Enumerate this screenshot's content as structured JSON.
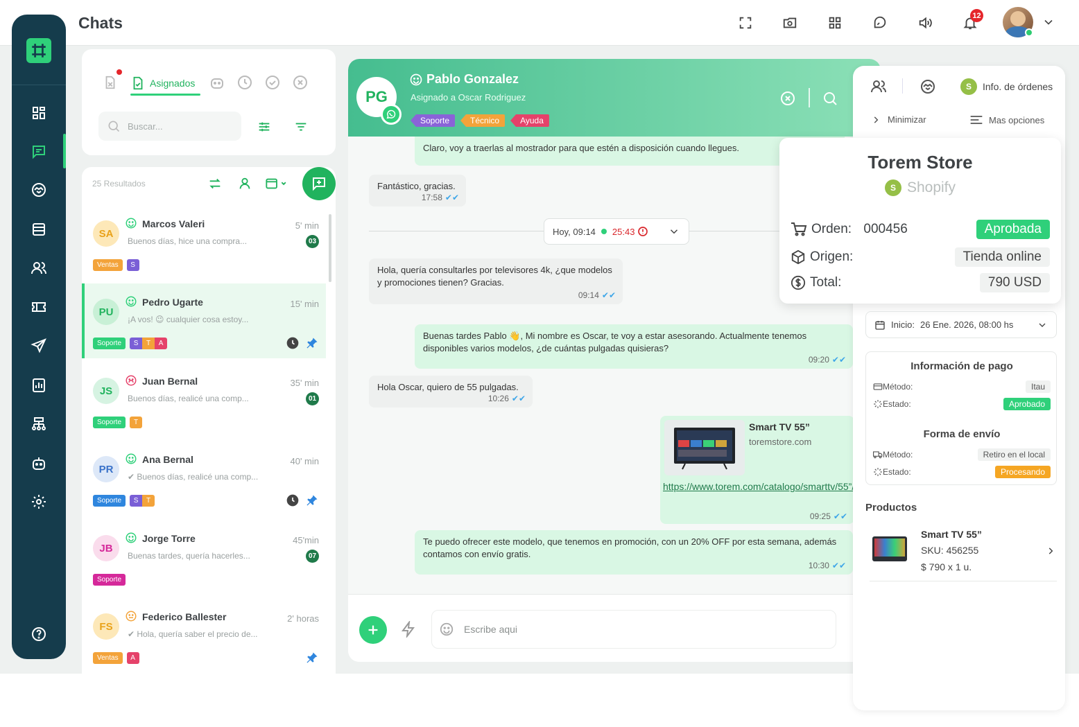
{
  "header": {
    "title": "Chats",
    "icons": [
      "fullscreen-icon",
      "camera-folder-icon",
      "apps-grid-icon",
      "chat-bubble-icon",
      "volume-icon",
      "bell-icon"
    ],
    "notifications_count": "12"
  },
  "sidebar": {
    "items": [
      "dashboard-icon",
      "chat-icon",
      "handshake-icon",
      "list-icon",
      "users-icon",
      "ticket-icon",
      "send-icon",
      "stats-icon",
      "org-chart-icon",
      "bot-icon",
      "settings-icon",
      "help-icon"
    ]
  },
  "list_filters": {
    "active_tab": "Asignados",
    "search_placeholder": "Buscar..."
  },
  "chat_list": {
    "results": "25 Resultados",
    "items": [
      {
        "initials": "SA",
        "name": "Marcos Valeri",
        "preview": "Buenos días, hice una compra...",
        "time": "5' min",
        "badge": "03",
        "tag": "Ventas",
        "mini": [
          "S"
        ]
      },
      {
        "initials": "PU",
        "name": "Pedro Ugarte",
        "preview": "¡A vos! 😉 cualquier cosa estoy...",
        "time": "15' min",
        "badge": "",
        "tag": "Soporte",
        "mini": [
          "S",
          "T",
          "A"
        ]
      },
      {
        "initials": "JS",
        "name": "Juan Bernal",
        "preview": "Buenos días, realicé una comp...",
        "time": "35' min",
        "badge": "01",
        "tag": "Soporte",
        "mini": [
          "T"
        ]
      },
      {
        "initials": "PR",
        "name": "Ana Bernal",
        "preview": "✔ Buenos días, realicé una comp...",
        "time": "40' min",
        "badge": "",
        "tag": "Soporte",
        "mini": [
          "S",
          "T"
        ]
      },
      {
        "initials": "JB",
        "name": "Jorge Torre",
        "preview": "Buenas tardes, quería hacerles...",
        "time": "45'min",
        "badge": "07",
        "tag": "Soporte",
        "mini": []
      },
      {
        "initials": "FS",
        "name": "Federico Ballester",
        "preview": "✔ Hola, quería saber el precio de...",
        "time": "2' horas",
        "badge": "",
        "tag": "Ventas",
        "mini": [
          "A"
        ]
      }
    ]
  },
  "chat": {
    "avatar_initials": "PG",
    "contact_name": "Pablo Gonzalez",
    "assigned_to": "Asignado a Oscar Rodriguez",
    "tags": [
      "Soporte",
      "Técnico",
      "Ayuda"
    ],
    "date_label": "Hoy, 09:14",
    "timer": "25:43",
    "messages": [
      {
        "dir": "out",
        "text": "Claro, voy a traerlas al mostrador para que estén a disposición cuando llegues.",
        "time": ""
      },
      {
        "dir": "in",
        "text": "Fantástico, gracias.",
        "time": "17:58"
      },
      {
        "dir": "in",
        "text": "Hola, quería consultarles por televisores 4k, ¿que modelos y promociones tienen? Gracias.",
        "time": "09:14"
      },
      {
        "dir": "out",
        "text": "Buenas tardes Pablo 👋, Mi nombre es Oscar, te voy a estar asesorando. Actualmente tenemos disponibles varios modelos, ¿de cuántas pulgadas quisieras?",
        "time": "09:20"
      },
      {
        "dir": "in",
        "text": "Hola Oscar, quiero de 55 pulgadas.",
        "time": "10:26"
      },
      {
        "dir": "out",
        "text": "Te puedo ofrecer este modelo, que tenemos en promoción, con un 20% OFF por esta semana, además contamos con envío gratis.",
        "time": "10:30"
      }
    ],
    "link_preview": {
      "title": "Smart TV 55”",
      "domain": "toremstore.com",
      "url": "https://www.torem.com/catalogo/smarttv/55”/Torem",
      "time": "09:25"
    },
    "composer_placeholder": "Escribe aqui"
  },
  "right_panel": {
    "tab_orders": "Info. de órdenes",
    "minimize": "Minimizar",
    "more_options": "Mas opciones",
    "store": {
      "name": "Torem Store",
      "platform": "Shopify",
      "order_label": "Orden:",
      "order_number": "000456",
      "order_status": "Aprobada",
      "origin_label": "Origen:",
      "origin_value": "Tienda online",
      "total_label": "Total:",
      "total_value": "790 USD"
    },
    "start_label": "Inicio:",
    "start_value": "26 Ene. 2026, 08:00 hs",
    "payment": {
      "title": "Información de pago",
      "method_label": "Método:",
      "method_value": "Itau",
      "status_label": "Estado:",
      "status_value": "Aprobado"
    },
    "shipping": {
      "title": "Forma de envío",
      "method_label": "Método:",
      "method_value": "Retiro en el local",
      "status_label": "Estado:",
      "status_value": "Procesando"
    },
    "products_title": "Productos",
    "product": {
      "name": "Smart TV 55”",
      "sku": "SKU: 456255",
      "price": "$ 790 x 1 u."
    }
  },
  "colors": {
    "brand_green": "#2fd07a",
    "sidebar_bg": "#153c4c",
    "alert_red": "#e5262b"
  }
}
